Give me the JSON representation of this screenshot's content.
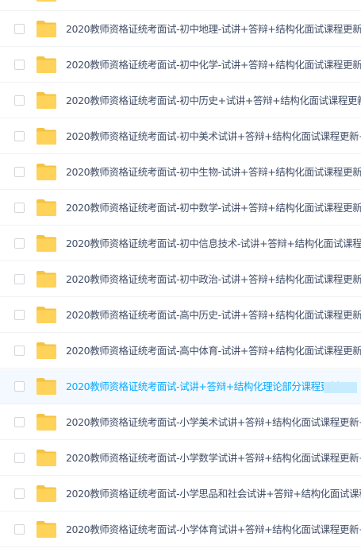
{
  "files": [
    {
      "name": "",
      "selected": false
    },
    {
      "name": "2020教师资格证统考面试-初中地理-试讲+答辩+结构化面试课程更新+",
      "selected": false
    },
    {
      "name": "2020教师资格证统考面试-初中化学-试讲+答辩+结构化面试课程更新+",
      "selected": false
    },
    {
      "name": "2020教师资格证统考面试-初中历史+试讲+答辩+结构化面试课程更新-",
      "selected": false
    },
    {
      "name": "2020教师资格证统考面试-初中美术试讲+答辩+结构化面试课程更新+V",
      "selected": false
    },
    {
      "name": "2020教师资格证统考面试-初中生物-试讲+答辩+结构化面试课程更新+",
      "selected": false
    },
    {
      "name": "2020教师资格证统考面试-初中数学-试讲+答辩+结构化面试课程更新+",
      "selected": false
    },
    {
      "name": "2020教师资格证统考面试-初中信息技术-试讲+答辩+结构化面试课程更",
      "selected": false
    },
    {
      "name": "2020教师资格证统考面试-初中政治-试讲+答辩+结构化面试课程更新+",
      "selected": false
    },
    {
      "name": "2020教师资格证统考面试-高中历史-试讲+答辩+结构化面试课程更新+",
      "selected": false
    },
    {
      "name": "2020教师资格证统考面试-高中体育-试讲+答辩+结构化面试课程更新+",
      "selected": false
    },
    {
      "name": "2020教师资格证统考面试-试讲+答辩+结构化理论部分课程更新",
      "selected": true
    },
    {
      "name": "2020教师资格证统考面试-小学美术试讲+答辩+结构化面试课程更新+V",
      "selected": false
    },
    {
      "name": "2020教师资格证统考面试-小学数学试讲+答辩+结构化面试课程更新+",
      "selected": false
    },
    {
      "name": "2020教师资格证统考面试-小学思品和社会试讲+答辩+结构化面试课程",
      "selected": false
    },
    {
      "name": "2020教师资格证统考面试-小学体育试讲+答辩+结构化面试课程更新+V",
      "selected": false
    },
    {
      "name": "",
      "selected": false
    }
  ],
  "colors": {
    "folder": "#ffd25a",
    "folder_tab": "#f5c342",
    "text": "#424e67",
    "selected_text": "#09aaff",
    "selected_bg": "#f3f9fe"
  },
  "icons": {
    "folder": "folder-icon",
    "checkbox": "checkbox-icon"
  }
}
